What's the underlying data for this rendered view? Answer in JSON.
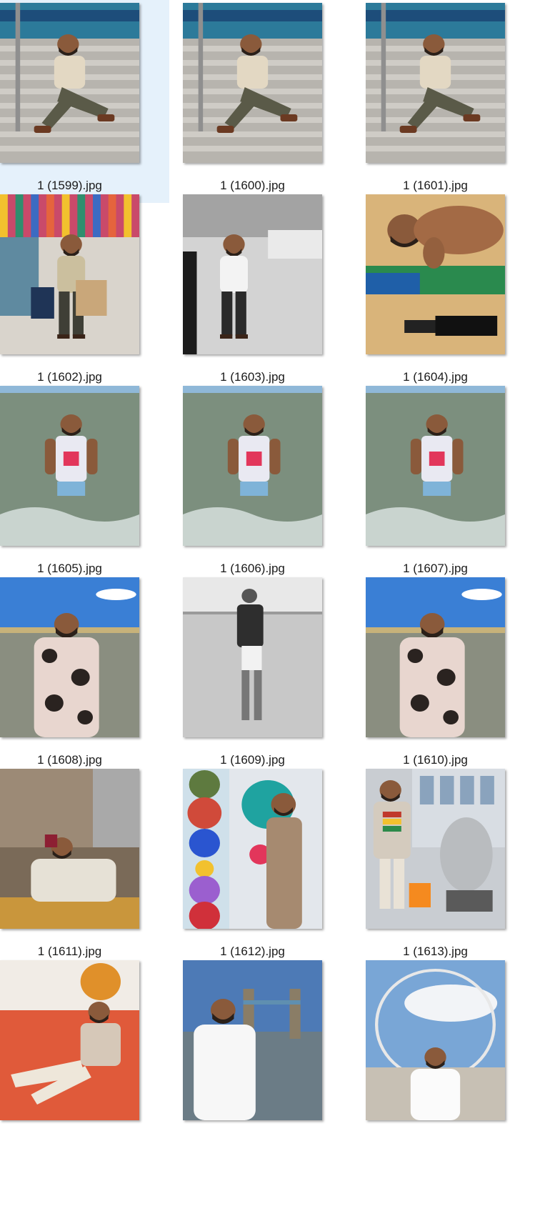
{
  "files": [
    {
      "name": "1 (1599).jpg",
      "selected": true,
      "scene": "stairs-stadium"
    },
    {
      "name": "1 (1600).jpg",
      "selected": false,
      "scene": "stairs-stadium"
    },
    {
      "name": "1 (1601).jpg",
      "selected": false,
      "scene": "stairs-stadium"
    },
    {
      "name": "1 (1602).jpg",
      "selected": false,
      "scene": "shopping-street"
    },
    {
      "name": "1 (1603).jpg",
      "selected": false,
      "scene": "bw-street"
    },
    {
      "name": "1 (1604).jpg",
      "selected": false,
      "scene": "beach-lying"
    },
    {
      "name": "1 (1605).jpg",
      "selected": false,
      "scene": "sea-wading"
    },
    {
      "name": "1 (1606).jpg",
      "selected": false,
      "scene": "sea-wading"
    },
    {
      "name": "1 (1607).jpg",
      "selected": false,
      "scene": "sea-wading"
    },
    {
      "name": "1 (1608).jpg",
      "selected": false,
      "scene": "beach-shirt"
    },
    {
      "name": "1 (1609).jpg",
      "selected": false,
      "scene": "bw-beach"
    },
    {
      "name": "1 (1610).jpg",
      "selected": false,
      "scene": "beach-shirt"
    },
    {
      "name": "1 (1611).jpg",
      "selected": false,
      "scene": "cafe"
    },
    {
      "name": "1 (1612).jpg",
      "selected": false,
      "scene": "colorful-gallery"
    },
    {
      "name": "1 (1613).jpg",
      "selected": false,
      "scene": "sculpture-street"
    },
    {
      "name": "",
      "selected": false,
      "scene": "colorful-lounge"
    },
    {
      "name": "",
      "selected": false,
      "scene": "tower-bridge"
    },
    {
      "name": "",
      "selected": false,
      "scene": "london-eye"
    }
  ],
  "colors": {
    "selection": "#e5f1fb",
    "caption": "#1a1a1a"
  }
}
